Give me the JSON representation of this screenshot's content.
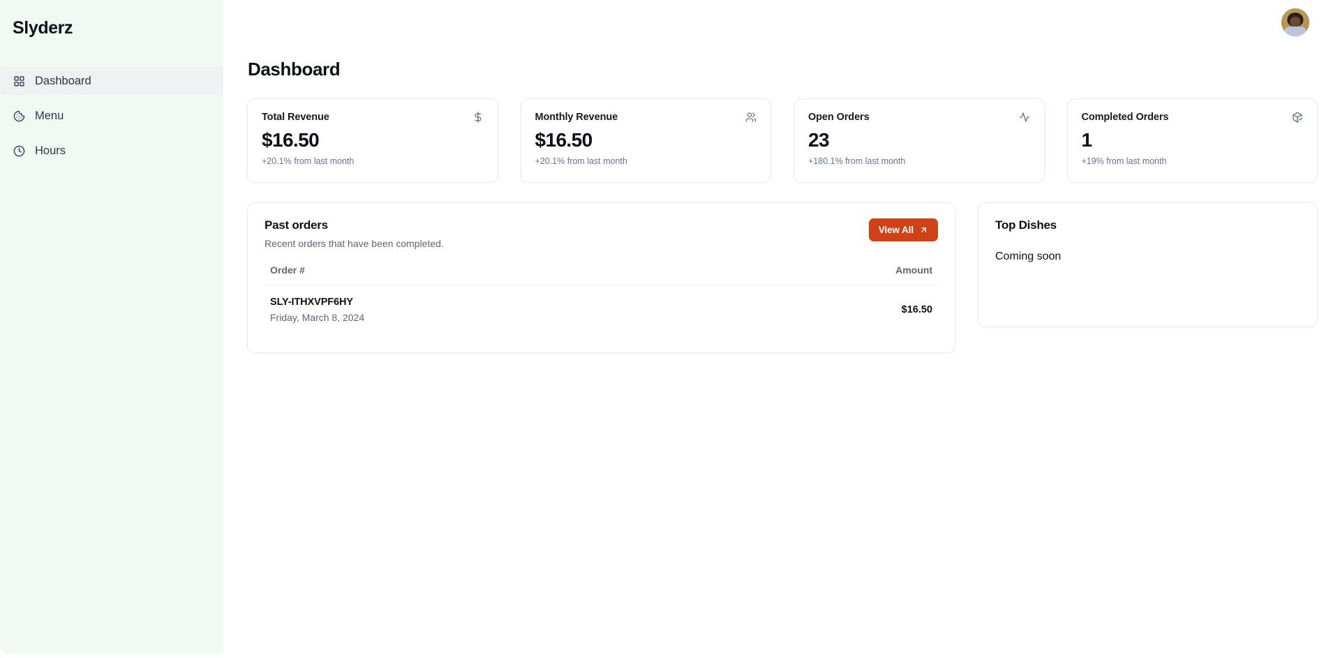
{
  "brand": {
    "name": "Slyderz"
  },
  "sidebar": {
    "items": [
      {
        "label": "Dashboard",
        "icon": "grid-icon",
        "active": true
      },
      {
        "label": "Menu",
        "icon": "cookie-icon",
        "active": false
      },
      {
        "label": "Hours",
        "icon": "clock-icon",
        "active": false
      }
    ]
  },
  "topbar": {
    "avatar_alt": "User avatar"
  },
  "page": {
    "title": "Dashboard"
  },
  "stats": [
    {
      "title": "Total Revenue",
      "value": "$16.50",
      "sub": "+20.1% from last month",
      "icon": "dollar-sign-icon"
    },
    {
      "title": "Monthly Revenue",
      "value": "$16.50",
      "sub": "+20.1% from last month",
      "icon": "users-icon"
    },
    {
      "title": "Open Orders",
      "value": "23",
      "sub": "+180.1% from last month",
      "icon": "activity-icon"
    },
    {
      "title": "Completed Orders",
      "value": "1",
      "sub": "+19% from last month",
      "icon": "package-check-icon"
    }
  ],
  "past_orders": {
    "title": "Past orders",
    "subtitle": "Recent orders that have been completed.",
    "view_all_label": "View All",
    "view_all_icon": "arrow-up-right-icon",
    "columns": [
      "Order #",
      "Amount"
    ],
    "rows": [
      {
        "order_id": "SLY-ITHXVPF6HY",
        "date": "Friday, March 8, 2024",
        "amount": "$16.50"
      }
    ]
  },
  "top_dishes": {
    "title": "Top Dishes",
    "body": "Coming soon"
  },
  "colors": {
    "sidebar_bg": "#f0faf2",
    "accent": "#cf4116",
    "card_border": "#e8eaee",
    "muted_text": "#64748b",
    "active_nav_bg": "#eef0f2"
  }
}
